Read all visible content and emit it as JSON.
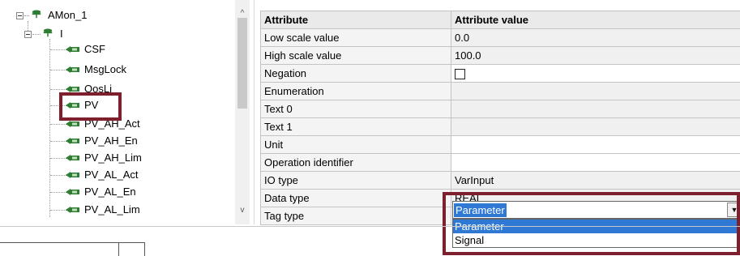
{
  "tree": {
    "nodes": [
      {
        "label": "AMon_1"
      },
      {
        "label": "I"
      },
      {
        "label": "CSF"
      },
      {
        "label": "MsgLock"
      },
      {
        "label": "OosLi"
      },
      {
        "label": "PV"
      },
      {
        "label": "PV_AH_Act"
      },
      {
        "label": "PV_AH_En"
      },
      {
        "label": "PV_AH_Lim"
      },
      {
        "label": "PV_AL_Act"
      },
      {
        "label": "PV_AL_En"
      },
      {
        "label": "PV_AL_Lim"
      }
    ],
    "scroll_up": "^",
    "scroll_down": "v"
  },
  "grid": {
    "headers": {
      "attribute": "Attribute",
      "value": "Attribute value"
    },
    "rows": [
      {
        "attribute": "Low scale value",
        "value": "0.0"
      },
      {
        "attribute": "High scale value",
        "value": "100.0"
      },
      {
        "attribute": "Negation",
        "value": ""
      },
      {
        "attribute": "Enumeration",
        "value": ""
      },
      {
        "attribute": "Text 0",
        "value": ""
      },
      {
        "attribute": "Text 1",
        "value": ""
      },
      {
        "attribute": "Unit",
        "value": ""
      },
      {
        "attribute": "Operation identifier",
        "value": ""
      },
      {
        "attribute": "IO type",
        "value": "VarInput"
      },
      {
        "attribute": "Data type",
        "value": "REAL"
      },
      {
        "attribute": "Tag type",
        "value": ""
      }
    ]
  },
  "tag_type": {
    "selected": "Parameter",
    "options": [
      "Parameter",
      "Signal"
    ]
  },
  "colors": {
    "highlight_border": "#7e1f2e",
    "selection": "#2f79d4",
    "header_bg": "#eaeaea",
    "connector_icon": "#2e7d32"
  }
}
